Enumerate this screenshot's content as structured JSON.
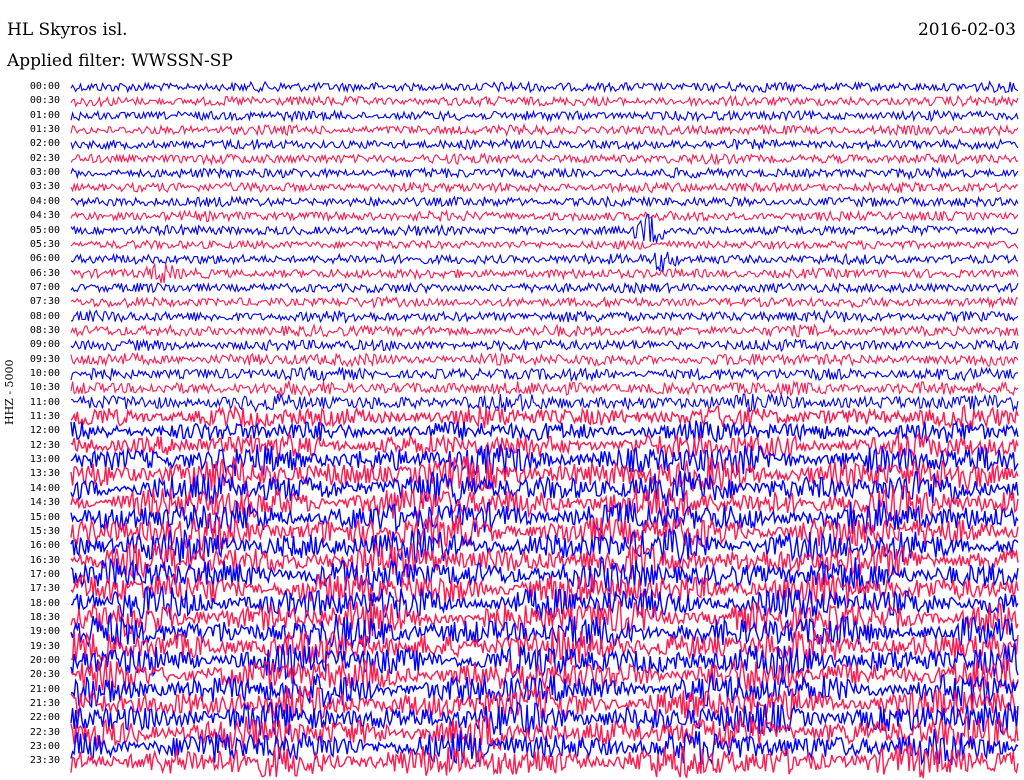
{
  "header": {
    "station": "HL Skyros isl.",
    "date": "2016-02-03",
    "filter": "Applied filter: WWSSN-SP"
  },
  "channel_label": "HHZ - 5000",
  "colors": {
    "trace_a": "#0000ff",
    "trace_b": "#ff1a4f",
    "background": "#ffffff"
  },
  "chart_data": {
    "type": "line",
    "title": "HL Skyros isl.",
    "ylabel": "HHZ - 5000",
    "row_labels": [
      "00:00",
      "00:30",
      "01:00",
      "01:30",
      "02:00",
      "02:30",
      "03:00",
      "03:30",
      "04:00",
      "04:30",
      "05:00",
      "05:30",
      "06:00",
      "06:30",
      "07:00",
      "07:30",
      "08:00",
      "08:30",
      "09:00",
      "09:30",
      "10:00",
      "10:30",
      "11:00",
      "11:30",
      "12:00",
      "12:30",
      "13:00",
      "13:30",
      "14:00",
      "14:30",
      "15:00",
      "15:30",
      "16:00",
      "16:30",
      "17:00",
      "17:30",
      "18:00",
      "18:30",
      "19:00",
      "19:30",
      "20:00",
      "20:30",
      "21:00",
      "21:30",
      "22:00",
      "22:30",
      "23:00",
      "23:30"
    ],
    "row_noise_level": [
      0.15,
      0.15,
      0.15,
      0.15,
      0.15,
      0.15,
      0.15,
      0.15,
      0.15,
      0.15,
      0.15,
      0.1,
      0.15,
      0.15,
      0.15,
      0.15,
      0.2,
      0.2,
      0.2,
      0.25,
      0.25,
      0.3,
      0.4,
      0.55,
      0.55,
      0.7,
      0.9,
      1.0,
      1.0,
      1.0,
      1.0,
      1.0,
      1.0,
      1.0,
      1.0,
      1.0,
      1.0,
      1.0,
      1.0,
      1.0,
      1.0,
      1.0,
      1.0,
      1.0,
      1.0,
      1.0,
      1.0,
      1.0
    ],
    "events": [
      {
        "row": "05:00",
        "position": 0.61,
        "amplitude": 0.9
      },
      {
        "row": "06:00",
        "position": 0.625,
        "amplitude": 0.6
      },
      {
        "row": "06:30",
        "position": 0.095,
        "amplitude": 0.5
      }
    ],
    "grid": false
  }
}
